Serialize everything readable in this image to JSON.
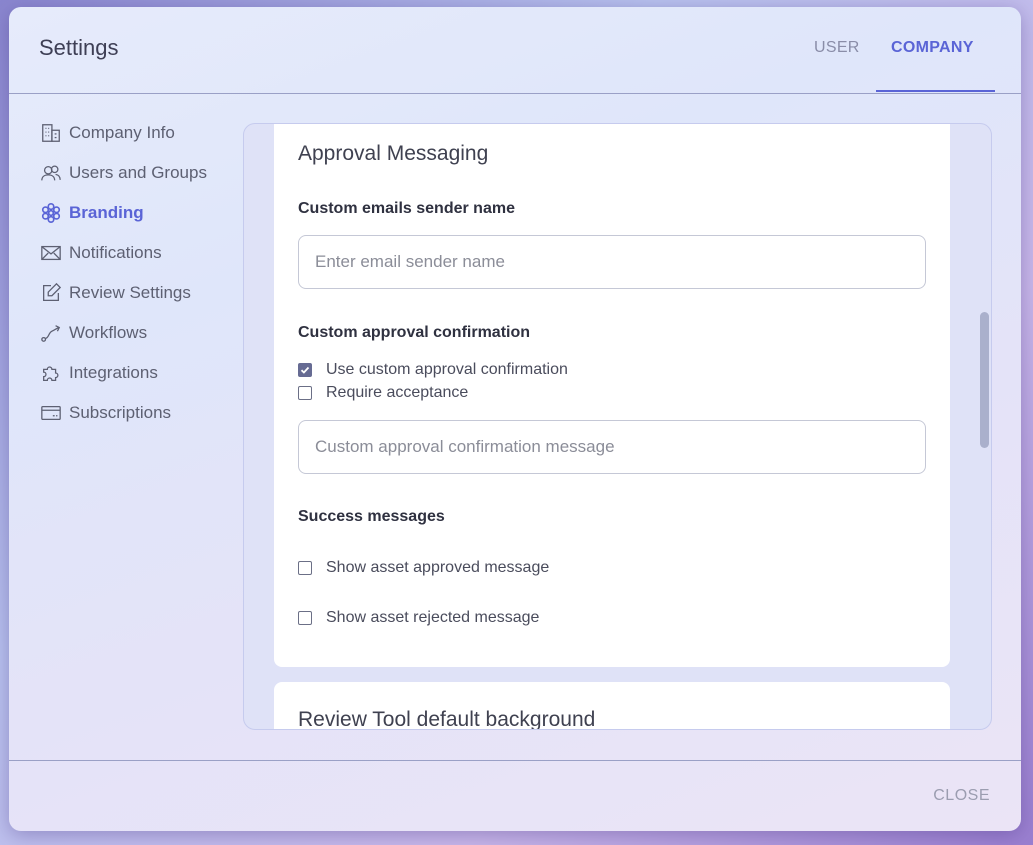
{
  "header": {
    "title": "Settings",
    "tabs": [
      {
        "label": "USER"
      },
      {
        "label": "COMPANY"
      }
    ]
  },
  "sidebar": {
    "items": [
      {
        "label": "Company Info",
        "icon": "building-icon"
      },
      {
        "label": "Users and Groups",
        "icon": "users-icon"
      },
      {
        "label": "Branding",
        "icon": "flower-icon",
        "active": true
      },
      {
        "label": "Notifications",
        "icon": "envelope-icon"
      },
      {
        "label": "Review Settings",
        "icon": "edit-icon"
      },
      {
        "label": "Workflows",
        "icon": "route-icon"
      },
      {
        "label": "Integrations",
        "icon": "puzzle-icon"
      },
      {
        "label": "Subscriptions",
        "icon": "card-icon"
      }
    ]
  },
  "approval": {
    "title": "Approval Messaging",
    "sender_label": "Custom emails sender name",
    "sender_placeholder": "Enter email sender name",
    "sender_value": "",
    "confirm_label": "Custom approval confirmation",
    "use_custom_label": "Use custom approval confirmation",
    "use_custom_checked": true,
    "require_accept_label": "Require acceptance",
    "require_accept_checked": false,
    "confirm_placeholder": "Custom approval confirmation message",
    "confirm_value": "",
    "success_label": "Success messages",
    "approved_label": "Show asset approved message",
    "approved_checked": false,
    "rejected_label": "Show asset rejected message",
    "rejected_checked": false
  },
  "review_tool": {
    "title": "Review Tool default background"
  },
  "footer": {
    "close_label": "CLOSE"
  },
  "colors": {
    "accent": "#5a64d6",
    "checkbox_checked": "#666b93"
  }
}
